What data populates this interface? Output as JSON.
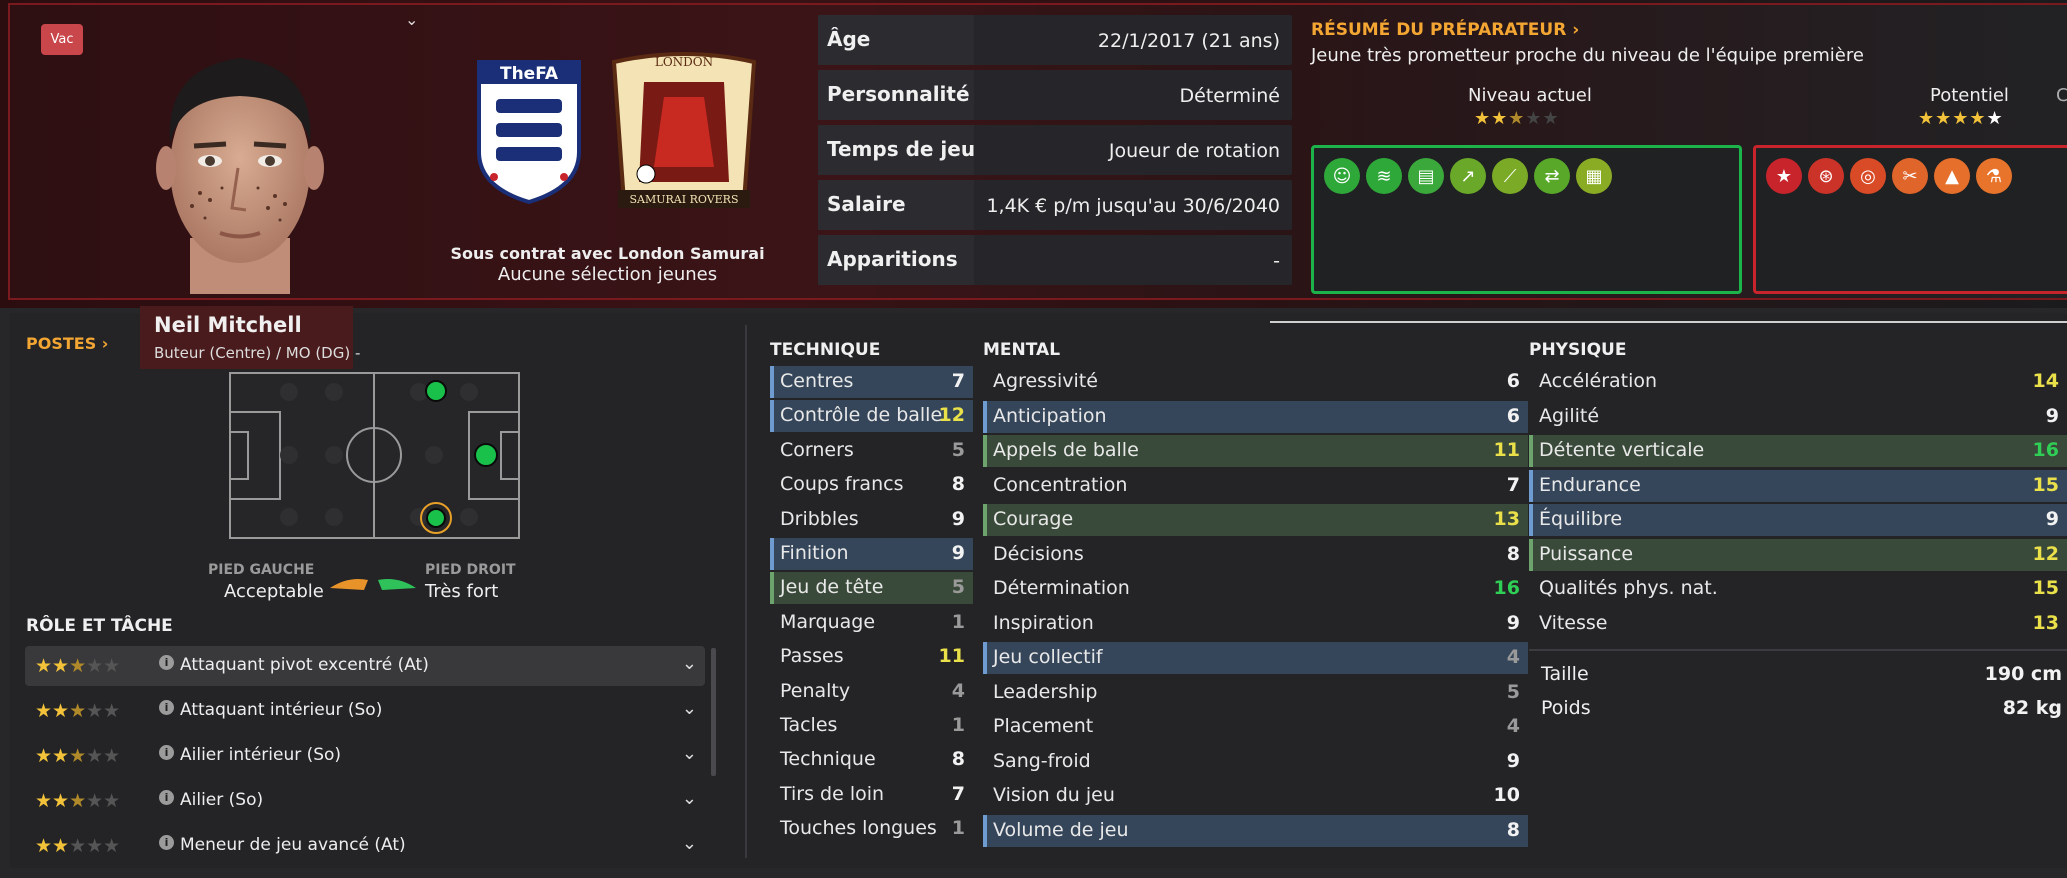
{
  "header": {
    "badge": "Vac",
    "contract_line1": "Sous contrat avec London Samurai",
    "contract_line2": "Aucune sélection jeunes",
    "club_top": "LONDON",
    "club_bottom": "SAMURAI ROVERS",
    "fa_logo": "TheFA"
  },
  "info": [
    {
      "label": "Âge",
      "value": "22/1/2017 (21 ans)"
    },
    {
      "label": "Personnalité",
      "value": "Déterminé"
    },
    {
      "label": "Temps de jeu",
      "value": "Joueur de rotation"
    },
    {
      "label": "Salaire",
      "value": "1,4K € p/m jusqu'au 30/6/2040"
    },
    {
      "label": "Apparitions",
      "value": "-"
    }
  ],
  "scout": {
    "title": "RÉSUMÉ DU PRÉPARATEUR",
    "summary": "Jeune très prometteur proche du niveau de l'équipe première",
    "current_label": "Niveau actuel",
    "current_stars": 2.5,
    "potential_label": "Potentiel",
    "potential_stars": 4.5
  },
  "traits_positive": [
    "brain-icon",
    "spring-icon",
    "document-icon",
    "trend-up-icon",
    "boot-icon",
    "handshake-icon",
    "notes-icon"
  ],
  "traits_negative": [
    "star-icon",
    "rings-icon",
    "target-icon",
    "scissors-icon",
    "cone-icon",
    "flask-icon"
  ],
  "player": {
    "name": "Neil Mitchell",
    "positions_line": "Buteur (Centre) / MO (DG) -"
  },
  "positions": {
    "title": "POSTES",
    "left_foot_label": "PIED GAUCHE",
    "left_foot_value": "Acceptable",
    "right_foot_label": "PIED DROIT",
    "right_foot_value": "Très fort"
  },
  "roles": {
    "title": "RÔLE ET TÂCHE",
    "items": [
      {
        "stars": 2.5,
        "label": "Attaquant pivot excentré (At)"
      },
      {
        "stars": 2.5,
        "label": "Attaquant intérieur (So)"
      },
      {
        "stars": 2.5,
        "label": "Ailier intérieur (So)"
      },
      {
        "stars": 2.5,
        "label": "Ailier (So)"
      },
      {
        "stars": 2,
        "label": "Meneur de jeu avancé (At)"
      }
    ]
  },
  "technique": {
    "title": "TECHNIQUE",
    "items": [
      {
        "name": "Centres",
        "value": "7",
        "hl": "blue",
        "c": "w"
      },
      {
        "name": "Contrôle de balle",
        "value": "12",
        "hl": "blue",
        "c": "y"
      },
      {
        "name": "Corners",
        "value": "5",
        "hl": "",
        "c": "g"
      },
      {
        "name": "Coups francs",
        "value": "8",
        "hl": "",
        "c": "w"
      },
      {
        "name": "Dribbles",
        "value": "9",
        "hl": "",
        "c": "w"
      },
      {
        "name": "Finition",
        "value": "9",
        "hl": "blue",
        "c": "w"
      },
      {
        "name": "Jeu de tête",
        "value": "5",
        "hl": "green",
        "c": "g"
      },
      {
        "name": "Marquage",
        "value": "1",
        "hl": "",
        "c": "g"
      },
      {
        "name": "Passes",
        "value": "11",
        "hl": "",
        "c": "y"
      },
      {
        "name": "Penalty",
        "value": "4",
        "hl": "",
        "c": "g"
      },
      {
        "name": "Tacles",
        "value": "1",
        "hl": "",
        "c": "g"
      },
      {
        "name": "Technique",
        "value": "8",
        "hl": "",
        "c": "w"
      },
      {
        "name": "Tirs de loin",
        "value": "7",
        "hl": "",
        "c": "w"
      },
      {
        "name": "Touches longues",
        "value": "1",
        "hl": "",
        "c": "g"
      }
    ]
  },
  "mental": {
    "title": "MENTAL",
    "items": [
      {
        "name": "Agressivité",
        "value": "6",
        "hl": "",
        "c": "w"
      },
      {
        "name": "Anticipation",
        "value": "6",
        "hl": "blue",
        "c": "w"
      },
      {
        "name": "Appels de balle",
        "value": "11",
        "hl": "green",
        "c": "y"
      },
      {
        "name": "Concentration",
        "value": "7",
        "hl": "",
        "c": "w"
      },
      {
        "name": "Courage",
        "value": "13",
        "hl": "green",
        "c": "y"
      },
      {
        "name": "Décisions",
        "value": "8",
        "hl": "",
        "c": "w"
      },
      {
        "name": "Détermination",
        "value": "16",
        "hl": "",
        "c": "gr"
      },
      {
        "name": "Inspiration",
        "value": "9",
        "hl": "",
        "c": "w"
      },
      {
        "name": "Jeu collectif",
        "value": "4",
        "hl": "blue",
        "c": "g"
      },
      {
        "name": "Leadership",
        "value": "5",
        "hl": "",
        "c": "g"
      },
      {
        "name": "Placement",
        "value": "4",
        "hl": "",
        "c": "g"
      },
      {
        "name": "Sang-froid",
        "value": "9",
        "hl": "",
        "c": "w"
      },
      {
        "name": "Vision du jeu",
        "value": "10",
        "hl": "",
        "c": "w"
      },
      {
        "name": "Volume de jeu",
        "value": "8",
        "hl": "blue",
        "c": "w"
      }
    ]
  },
  "physique": {
    "title": "PHYSIQUE",
    "items": [
      {
        "name": "Accélération",
        "value": "14",
        "hl": "",
        "c": "y"
      },
      {
        "name": "Agilité",
        "value": "9",
        "hl": "",
        "c": "w"
      },
      {
        "name": "Détente verticale",
        "value": "16",
        "hl": "green",
        "c": "gr"
      },
      {
        "name": "Endurance",
        "value": "15",
        "hl": "blue",
        "c": "y"
      },
      {
        "name": "Équilibre",
        "value": "9",
        "hl": "blue",
        "c": "w"
      },
      {
        "name": "Puissance",
        "value": "12",
        "hl": "green",
        "c": "y"
      },
      {
        "name": "Qualités phys. nat.",
        "value": "15",
        "hl": "",
        "c": "y"
      },
      {
        "name": "Vitesse",
        "value": "13",
        "hl": "",
        "c": "y"
      }
    ],
    "height_label": "Taille",
    "height_value": "190 cm",
    "weight_label": "Poids",
    "weight_value": "82 kg"
  },
  "colors": {
    "accent": "#f4a633",
    "positive_trait": "#2eb33a",
    "negative_trait": "#c8242b",
    "star": "#f2c23a"
  }
}
